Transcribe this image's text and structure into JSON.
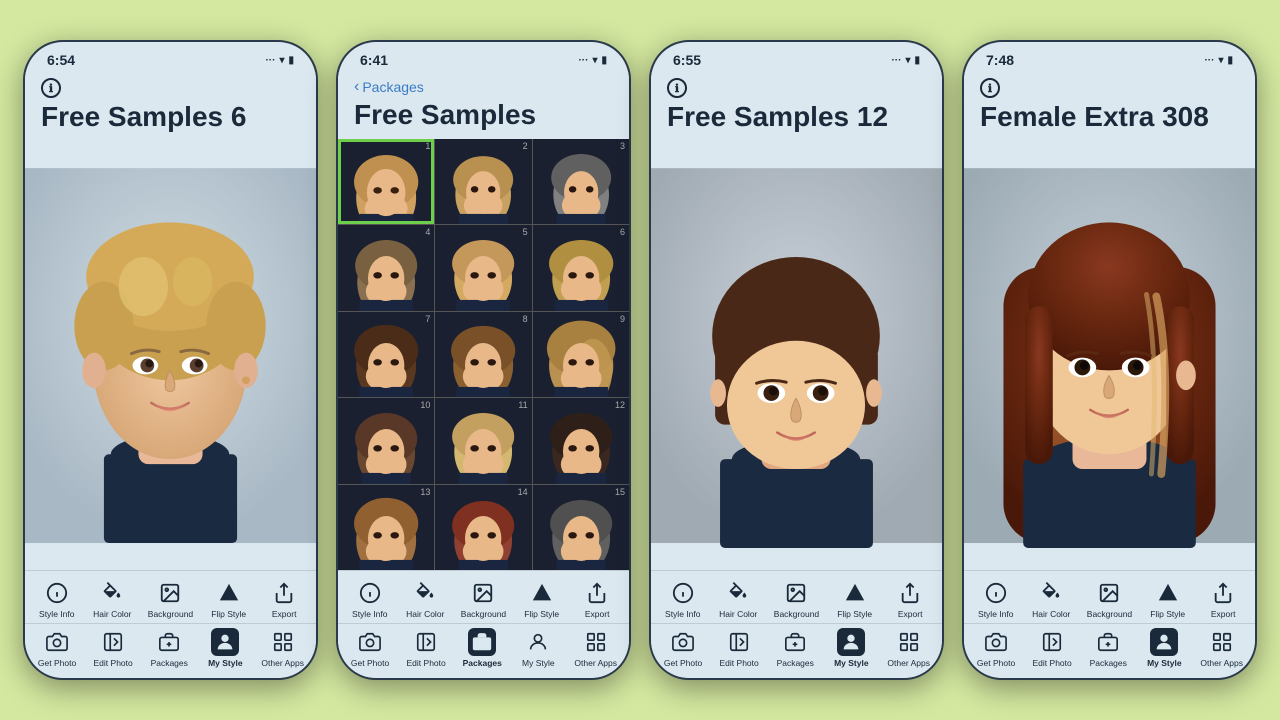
{
  "background_color": "#d4e8a0",
  "phones": [
    {
      "id": "phone-1",
      "time": "6:54",
      "header_icon": "ℹ",
      "title": "Free Samples 6",
      "has_back": false,
      "back_label": "",
      "back_nav": "",
      "content_type": "portrait",
      "toolbar_top": [
        {
          "id": "style-info",
          "icon": "ℹ",
          "label": "Style Info",
          "active": false
        },
        {
          "id": "hair-color",
          "icon": "🪣",
          "label": "Hair Color",
          "active": false
        },
        {
          "id": "background",
          "icon": "🖼",
          "label": "Background",
          "active": false
        },
        {
          "id": "flip-style",
          "icon": "▲",
          "label": "Flip Style",
          "active": false
        },
        {
          "id": "export",
          "icon": "↗",
          "label": "Export",
          "active": false
        }
      ],
      "toolbar_bottom": [
        {
          "id": "get-photo",
          "icon": "📷",
          "label": "Get Photo",
          "active": false
        },
        {
          "id": "edit-photo",
          "icon": "✂",
          "label": "Edit Photo",
          "active": false
        },
        {
          "id": "packages",
          "icon": "📦",
          "label": "Packages",
          "active": false
        },
        {
          "id": "my-style",
          "icon": "👤",
          "label": "My Style",
          "active": true
        },
        {
          "id": "other-apps",
          "icon": "⬜",
          "label": "Other Apps",
          "active": false
        }
      ]
    },
    {
      "id": "phone-2",
      "time": "6:41",
      "header_icon": null,
      "title": "Free Samples",
      "has_back": true,
      "back_label": "Packages",
      "back_nav": "‹ Packages",
      "content_type": "grid",
      "grid_items": [
        {
          "num": 1,
          "selected": true
        },
        {
          "num": 2,
          "selected": false
        },
        {
          "num": 3,
          "selected": false
        },
        {
          "num": 4,
          "selected": false
        },
        {
          "num": 5,
          "selected": false
        },
        {
          "num": 6,
          "selected": false
        },
        {
          "num": 7,
          "selected": false
        },
        {
          "num": 8,
          "selected": false
        },
        {
          "num": 9,
          "selected": false
        },
        {
          "num": 10,
          "selected": false
        },
        {
          "num": 11,
          "selected": false
        },
        {
          "num": 12,
          "selected": false
        },
        {
          "num": 13,
          "selected": false
        },
        {
          "num": 14,
          "selected": false
        },
        {
          "num": 15,
          "selected": false
        }
      ],
      "toolbar_top": [
        {
          "id": "style-info",
          "icon": "ℹ",
          "label": "Style Info",
          "active": false
        },
        {
          "id": "hair-color",
          "icon": "🪣",
          "label": "Hair Color",
          "active": false
        },
        {
          "id": "background",
          "icon": "🖼",
          "label": "Background",
          "active": false
        },
        {
          "id": "flip-style",
          "icon": "▲",
          "label": "Flip Style",
          "active": false
        },
        {
          "id": "export",
          "icon": "↗",
          "label": "Export",
          "active": false
        }
      ],
      "toolbar_bottom": [
        {
          "id": "get-photo",
          "icon": "📷",
          "label": "Get Photo",
          "active": false
        },
        {
          "id": "edit-photo",
          "icon": "✂",
          "label": "Edit Photo",
          "active": false
        },
        {
          "id": "packages",
          "icon": "📦",
          "label": "Packages",
          "active": true
        },
        {
          "id": "my-style",
          "icon": "👤",
          "label": "My Style",
          "active": false
        },
        {
          "id": "other-apps",
          "icon": "⬜",
          "label": "Other Apps",
          "active": false
        }
      ]
    },
    {
      "id": "phone-3",
      "time": "6:55",
      "header_icon": "ℹ",
      "title": "Free Samples 12",
      "has_back": false,
      "back_label": "",
      "back_nav": "",
      "content_type": "portrait",
      "toolbar_top": [
        {
          "id": "style-info",
          "icon": "ℹ",
          "label": "Style Info",
          "active": false
        },
        {
          "id": "hair-color",
          "icon": "🪣",
          "label": "Hair Color",
          "active": false
        },
        {
          "id": "background",
          "icon": "🖼",
          "label": "Background",
          "active": false
        },
        {
          "id": "flip-style",
          "icon": "▲",
          "label": "Flip Style",
          "active": false
        },
        {
          "id": "export",
          "icon": "↗",
          "label": "Export",
          "active": false
        }
      ],
      "toolbar_bottom": [
        {
          "id": "get-photo",
          "icon": "📷",
          "label": "Get Photo",
          "active": false
        },
        {
          "id": "edit-photo",
          "icon": "✂",
          "label": "Edit Photo",
          "active": false
        },
        {
          "id": "packages",
          "icon": "📦",
          "label": "Packages",
          "active": false
        },
        {
          "id": "my-style",
          "icon": "👤",
          "label": "My Style",
          "active": true
        },
        {
          "id": "other-apps",
          "icon": "⬜",
          "label": "Other Apps",
          "active": false
        }
      ]
    },
    {
      "id": "phone-4",
      "time": "7:48",
      "header_icon": "ℹ",
      "title": "Female Extra 308",
      "has_back": false,
      "back_label": "",
      "back_nav": "",
      "content_type": "portrait",
      "toolbar_top": [
        {
          "id": "style-info",
          "icon": "ℹ",
          "label": "Style Info",
          "active": false
        },
        {
          "id": "hair-color",
          "icon": "🪣",
          "label": "Hair Color",
          "active": false
        },
        {
          "id": "background",
          "icon": "🖼",
          "label": "Background",
          "active": false
        },
        {
          "id": "flip-style",
          "icon": "▲",
          "label": "Flip Style",
          "active": false
        },
        {
          "id": "export",
          "icon": "↗",
          "label": "Export",
          "active": false
        }
      ],
      "toolbar_bottom": [
        {
          "id": "get-photo",
          "icon": "📷",
          "label": "Get Photo",
          "active": false
        },
        {
          "id": "edit-photo",
          "icon": "✂",
          "label": "Edit Photo",
          "active": false
        },
        {
          "id": "packages",
          "icon": "📦",
          "label": "Packages",
          "active": false
        },
        {
          "id": "my-style",
          "icon": "👤",
          "label": "My Style",
          "active": true
        },
        {
          "id": "other-apps",
          "icon": "⬜",
          "label": "Other Apps",
          "active": false
        }
      ]
    }
  ],
  "toolbar_labels": {
    "style_info": "Style Info",
    "hair_color": "Hair Color",
    "background": "Background",
    "flip_style": "Flip Style",
    "export": "Export",
    "get_photo": "Get Photo",
    "edit_photo": "Edit Photo",
    "packages": "Packages",
    "my_style": "My Style",
    "other_apps": "Other Apps"
  }
}
